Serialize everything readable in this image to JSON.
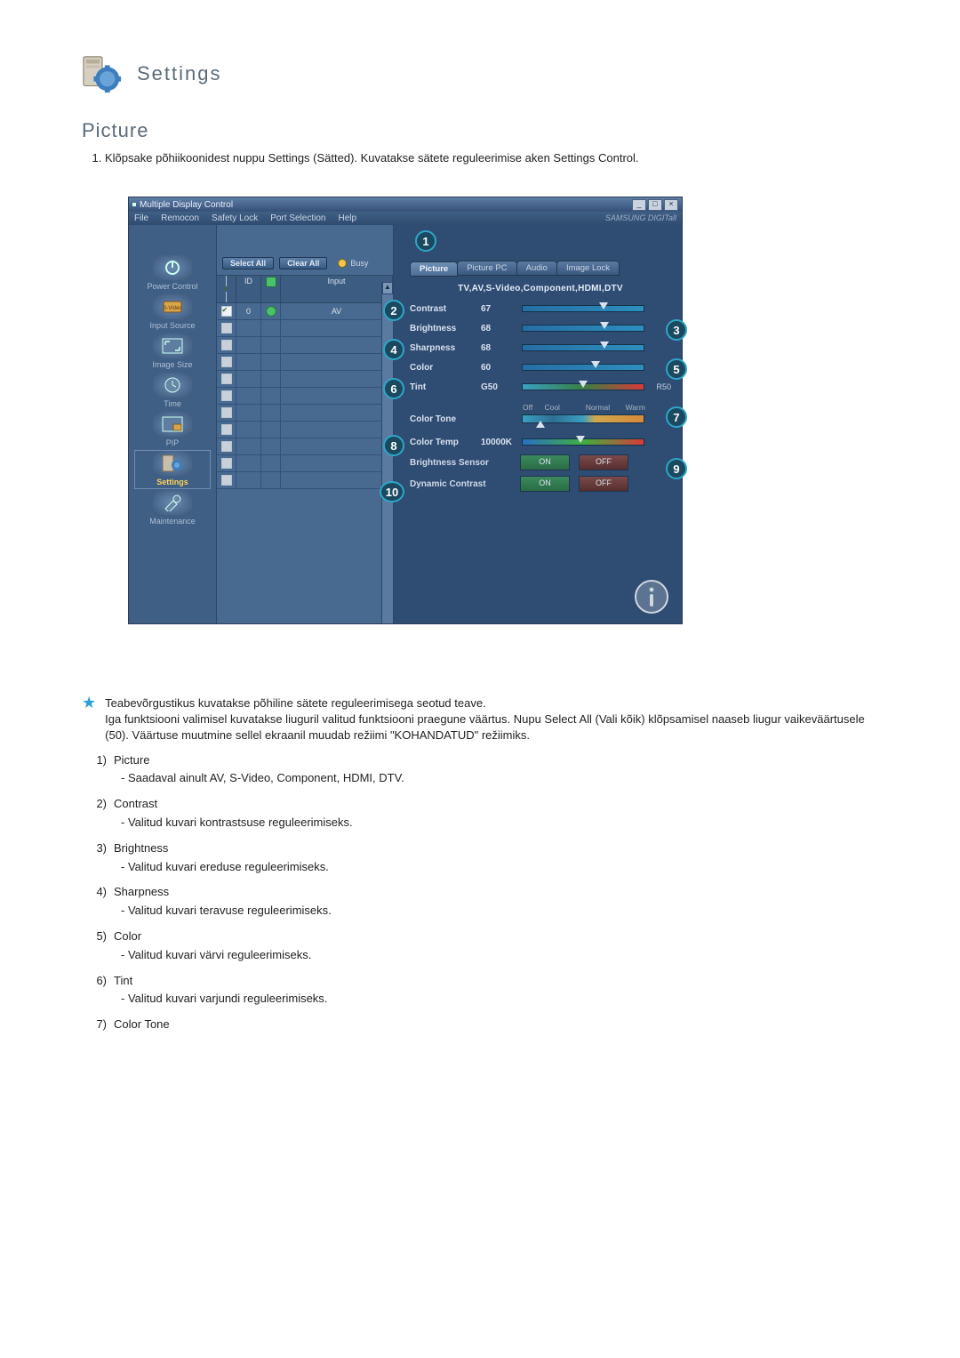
{
  "header": {
    "title": "Settings"
  },
  "section": {
    "title": "Picture"
  },
  "intro": "Klõpsake põhiikoonidest nuppu Settings (Sätted). Kuvatakse sätete reguleerimise aken Settings Control.",
  "mdc": {
    "title": "Multiple Display Control",
    "menu": [
      "File",
      "Remocon",
      "Safety Lock",
      "Port Selection",
      "Help"
    ],
    "brand": "SAMSUNG DIGITall",
    "sidebar": [
      {
        "label": "Power Control"
      },
      {
        "label": "Input Source"
      },
      {
        "label": "Image Size"
      },
      {
        "label": "Time"
      },
      {
        "label": "PIP"
      },
      {
        "label": "Settings",
        "active": true
      },
      {
        "label": "Maintenance"
      }
    ],
    "list": {
      "select_all": "Select All",
      "clear_all": "Clear All",
      "busy": "Busy",
      "cols": {
        "id": "ID",
        "input": "Input"
      },
      "rows": [
        {
          "checked": true,
          "id": "0",
          "input": "AV",
          "statusGreen": true
        }
      ],
      "empty_rows": 10
    },
    "panel": {
      "tabs": [
        "Picture",
        "Picture PC",
        "Audio",
        "Image Lock"
      ],
      "active_tab": 0,
      "source_line": "TV,AV,S-Video,Component,HDMI,DTV",
      "sliders": [
        {
          "key": "contrast",
          "label": "Contrast",
          "value": "67",
          "pct": 67,
          "type": "normal"
        },
        {
          "key": "brightness",
          "label": "Brightness",
          "value": "68",
          "pct": 68,
          "type": "normal"
        },
        {
          "key": "sharpness",
          "label": "Sharpness",
          "value": "68",
          "pct": 68,
          "type": "normal"
        },
        {
          "key": "color",
          "label": "Color",
          "value": "60",
          "pct": 60,
          "type": "normal"
        },
        {
          "key": "tint",
          "label": "Tint",
          "value": "G50",
          "pct": 50,
          "type": "tint",
          "rightcap": "R50"
        }
      ],
      "color_tone": {
        "label": "Color Tone",
        "options": [
          "Off",
          "Cool",
          "Normal",
          "Warm"
        ],
        "pct": 15
      },
      "color_temp": {
        "label": "Color Temp",
        "value": "10000K",
        "pct": 48
      },
      "brightness_sensor": {
        "label": "Brightness Sensor",
        "on": "ON",
        "off": "OFF"
      },
      "dynamic_contrast": {
        "label": "Dynamic Contrast",
        "on": "ON",
        "off": "OFF"
      }
    }
  },
  "callouts": [
    "1",
    "2",
    "3",
    "4",
    "5",
    "6",
    "7",
    "8",
    "9",
    "10"
  ],
  "note": {
    "line1": "Teabevõrgustikus kuvatakse põhiline sätete reguleerimisega seotud teave.",
    "line2": "Iga funktsiooni valimisel kuvatakse liuguril valitud funktsiooni praegune väärtus. Nupu Select All (Vali kõik) klõpsamisel naaseb liugur vaikeväärtusele (50). Väärtuse muutmine sellel ekraanil muudab režiimi \"KOHANDATUD\" režiimiks."
  },
  "items": [
    {
      "num": "1)",
      "title": "Picture",
      "sub": "Saadaval ainult AV, S-Video, Component, HDMI, DTV."
    },
    {
      "num": "2)",
      "title": "Contrast",
      "sub": "Valitud kuvari kontrastsuse reguleerimiseks."
    },
    {
      "num": "3)",
      "title": "Brightness",
      "sub": "Valitud kuvari ereduse reguleerimiseks."
    },
    {
      "num": "4)",
      "title": "Sharpness",
      "sub": "Valitud kuvari teravuse reguleerimiseks."
    },
    {
      "num": "5)",
      "title": "Color",
      "sub": "Valitud kuvari värvi reguleerimiseks."
    },
    {
      "num": "6)",
      "title": "Tint",
      "sub": "Valitud kuvari varjundi reguleerimiseks."
    },
    {
      "num": "7)",
      "title": "Color Tone",
      "sub": ""
    }
  ]
}
